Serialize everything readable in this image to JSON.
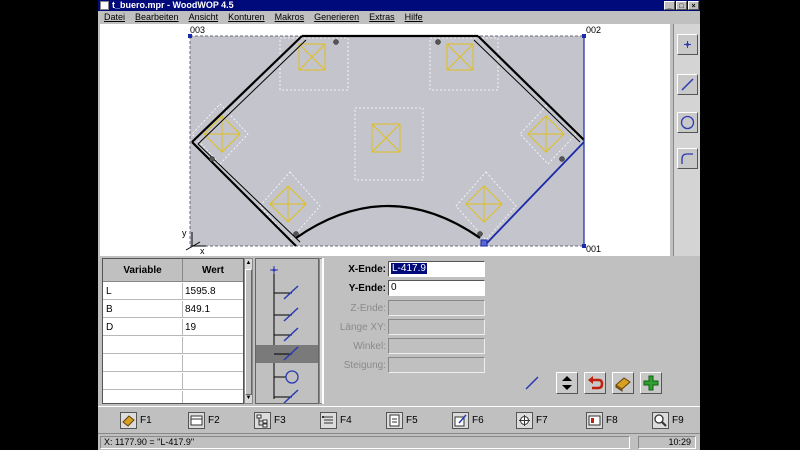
{
  "window": {
    "title": "t_buero.mpr - WoodWOP 4.5",
    "controls": [
      "_",
      "□",
      "×"
    ]
  },
  "menu": [
    "Datei",
    "Bearbeiten",
    "Ansicht",
    "Konturen",
    "Makros",
    "Generieren",
    "Extras",
    "Hilfe"
  ],
  "canvas": {
    "corner_labels": {
      "top_left": "003",
      "top_right": "002",
      "bottom_right": "001"
    },
    "axis": {
      "y": "y",
      "x": "x"
    },
    "colors": {
      "panel": "#c4c4cc",
      "contour": "#000000",
      "highlight": "#1a2aa8",
      "drill": "#e0c020",
      "guide": "#ffffff"
    }
  },
  "right_toolbar": {
    "tools": [
      "point-icon",
      "line-icon",
      "circle-icon",
      "arc-icon"
    ]
  },
  "variables": {
    "headers": {
      "variable": "Variable",
      "value": "Wert"
    },
    "rows": [
      {
        "name": "L",
        "value": "1595.8"
      },
      {
        "name": "B",
        "value": "849.1"
      },
      {
        "name": "D",
        "value": "19"
      },
      {
        "name": "",
        "value": ""
      },
      {
        "name": "",
        "value": ""
      },
      {
        "name": "",
        "value": ""
      },
      {
        "name": "",
        "value": ""
      }
    ]
  },
  "element_list": {
    "items": [
      "start-point-icon",
      "line-icon",
      "line-icon",
      "line-icon",
      "line-icon",
      "arc-icon",
      "line-icon"
    ],
    "selected_index": 4
  },
  "params": {
    "x_end": {
      "label": "X-Ende:",
      "value": "L-417.9"
    },
    "y_end": {
      "label": "Y-Ende:",
      "value": "0"
    },
    "z_end": {
      "label": "Z-Ende:",
      "value": ""
    },
    "length_xy": {
      "label": "Länge XY:",
      "value": ""
    },
    "angle": {
      "label": "Winkel:",
      "value": ""
    },
    "slope": {
      "label": "Steigung:",
      "value": ""
    }
  },
  "fkeys": [
    "F1",
    "F2",
    "F3",
    "F4",
    "F5",
    "F6",
    "F7",
    "F8",
    "F9"
  ],
  "status": {
    "message": "X: 1177.90 = \"L-417.9\"",
    "time": "10:29"
  }
}
